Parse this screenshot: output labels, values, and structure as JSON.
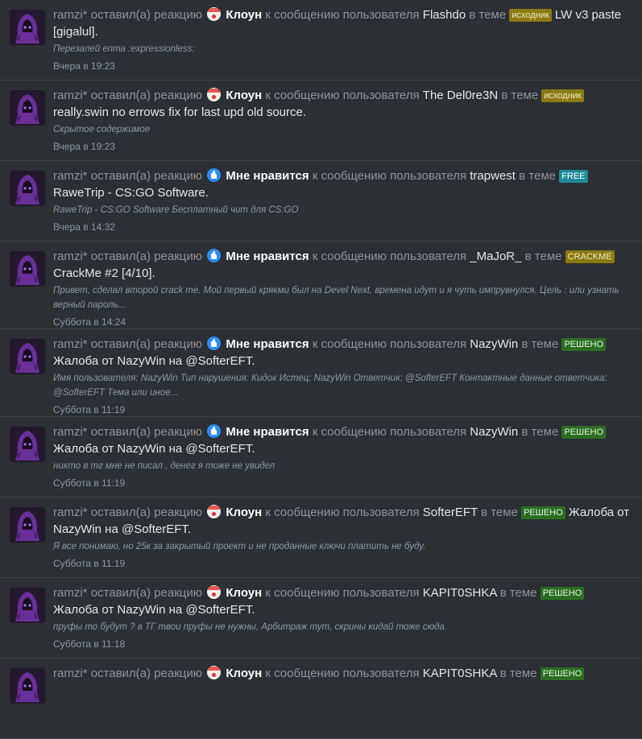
{
  "feed": {
    "items": [
      {
        "user": "ramzi*",
        "action": "оставил(а) реакцию",
        "reaction_icon": "clown-icon",
        "reaction": "Клоун",
        "mid": "к сообщению пользователя",
        "recipient": "Flashdo",
        "in_thread": "в теме",
        "prefix": "исходник",
        "prefix_type": "src",
        "title": "LW v3 paste [gigalul].",
        "snippet": "Перезалей епта :expressionless:",
        "time": "Вчера в 19:23"
      },
      {
        "user": "ramzi*",
        "action": "оставил(а) реакцию",
        "reaction_icon": "clown-icon",
        "reaction": "Клоун",
        "mid": "к сообщению пользователя",
        "recipient": "The Del0re3N",
        "in_thread": "в теме",
        "prefix": "исходник",
        "prefix_type": "src",
        "title": "really.swin no errows fix for last upd old source.",
        "snippet": "Скрытое содержимое",
        "time": "Вчера в 19:23"
      },
      {
        "user": "ramzi*",
        "action": "оставил(а) реакцию",
        "reaction_icon": "like-icon",
        "reaction": "Мне нравится",
        "mid": "к сообщению пользователя",
        "recipient": "trapwest",
        "in_thread": "в теме",
        "prefix": "FREE",
        "prefix_type": "free",
        "title": "RaweTrip - CS:GO Software.",
        "snippet": "RaweTrip - CS:GO Software Бесплатный чит для CS:GO",
        "time": "Вчера в 14:32"
      },
      {
        "user": "ramzi*",
        "action": "оставил(а) реакцию",
        "reaction_icon": "like-icon",
        "reaction": "Мне нравится",
        "mid": "к сообщению пользователя",
        "recipient": "_MaJoR_",
        "in_thread": "в теме",
        "prefix": "CRACKME",
        "prefix_type": "crack",
        "title": "CrackMe #2 [4/10].",
        "snippet": "Привет, сделал второй crack me. Мой первый крякми был на Devel Next, времена идут и я чуть импрувнулся. Цель : или узнать верный пароль...",
        "time": "Суббота в 14:24"
      },
      {
        "user": "ramzi*",
        "action": "оставил(а) реакцию",
        "reaction_icon": "like-icon",
        "reaction": "Мне нравится",
        "mid": "к сообщению пользователя",
        "recipient": "NazyWin",
        "in_thread": "в теме",
        "prefix": "РЕШЕНО",
        "prefix_type": "solved",
        "title": "Жалоба от NazyWin на @SofterEFT.",
        "snippet": "Имя пользователя: NazyWin Тип нарушения: Кидок Истец: NazyWin Ответчик: @SofterEFT Контактные данные ответчика: @SofterEFT Тема или иное...",
        "time": "Суббота в 11:19"
      },
      {
        "user": "ramzi*",
        "action": "оставил(а) реакцию",
        "reaction_icon": "like-icon",
        "reaction": "Мне нравится",
        "mid": "к сообщению пользователя",
        "recipient": "NazyWin",
        "in_thread": "в теме",
        "prefix": "РЕШЕНО",
        "prefix_type": "solved",
        "title": "Жалоба от NazyWin на @SofterEFT.",
        "snippet": "никто в тг мне не писал , денег я тоже не увидел",
        "time": "Суббота в 11:19"
      },
      {
        "user": "ramzi*",
        "action": "оставил(а) реакцию",
        "reaction_icon": "clown-icon",
        "reaction": "Клоун",
        "mid": "к сообщению пользователя",
        "recipient": "SofterEFT",
        "in_thread": "в теме",
        "prefix": "РЕШЕНО",
        "prefix_type": "solved",
        "title": "Жалоба от NazyWin на @SofterEFT.",
        "snippet": "Я все понимаю, но 25к за закрытый проект и не проданные ключи платить не буду.",
        "time": "Суббота в 11:19"
      },
      {
        "user": "ramzi*",
        "action": "оставил(а) реакцию",
        "reaction_icon": "clown-icon",
        "reaction": "Клоун",
        "mid": "к сообщению пользователя",
        "recipient": "KAPIT0SHKA",
        "in_thread": "в теме",
        "prefix": "РЕШЕНО",
        "prefix_type": "solved",
        "title": "Жалоба от NazyWin на @SofterEFT.",
        "snippet": "пруфы то будут ? в ТГ твои пруфы не нужны, Арбитраж тут, скрины кидай тоже сюда.",
        "time": "Суббота в 11:18"
      },
      {
        "user": "ramzi*",
        "action": "оставил(а) реакцию",
        "reaction_icon": "clown-icon",
        "reaction": "Клоун",
        "mid": "к сообщению пользователя",
        "recipient": "KAPIT0SHKA",
        "in_thread": "в теме",
        "prefix": "РЕШЕНО",
        "prefix_type": "solved",
        "title": "",
        "snippet": "",
        "time": ""
      }
    ]
  }
}
